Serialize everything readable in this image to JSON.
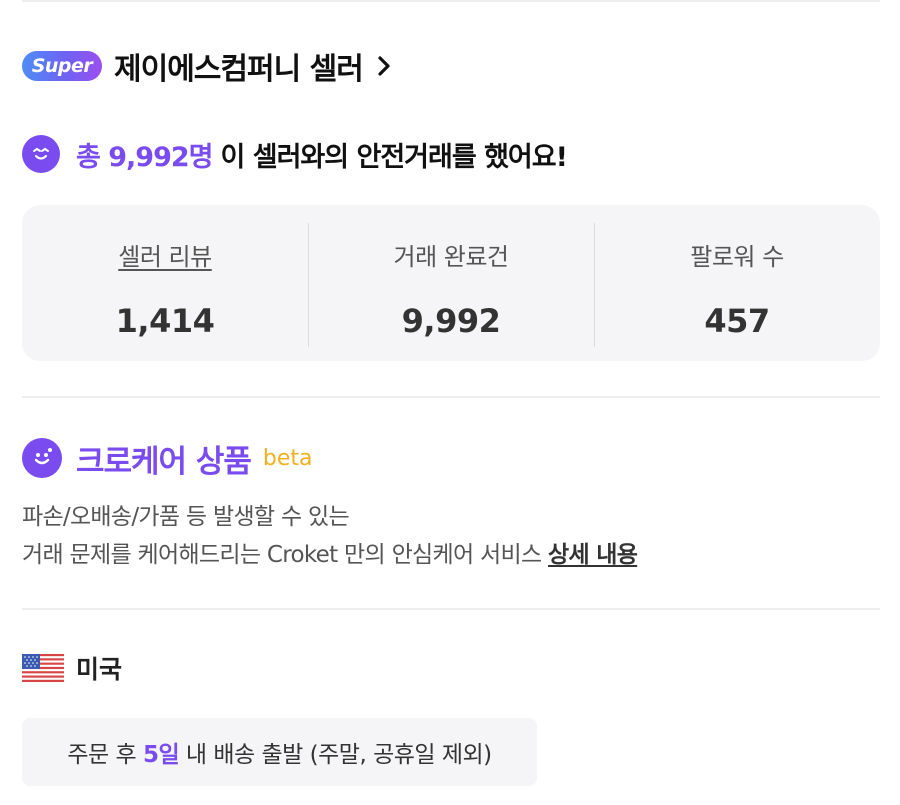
{
  "seller": {
    "badge": "Super",
    "name": "제이에스컴퍼니 셀러"
  },
  "trade": {
    "count_text": "총 9,992명",
    "suffix_text": "이 셀러와의 안전거래를 했어요!"
  },
  "stats": [
    {
      "label": "셀러 리뷰",
      "value": "1,414"
    },
    {
      "label": "거래 완료건",
      "value": "9,992"
    },
    {
      "label": "팔로워 수",
      "value": "457"
    }
  ],
  "crocare": {
    "title": "크로케어 상품",
    "beta": "beta",
    "line1": "파손/오배송/가품 등 발생할 수 있는",
    "line2": "거래 문제를 케어해드리는 Croket 만의 안심케어 서비스",
    "link": "상세 내용"
  },
  "country": {
    "name": "미국"
  },
  "shipping": {
    "prefix": "주문 후",
    "days": "5일",
    "suffix": "내 배송 출발 (주말, 공휴일 제외)"
  },
  "colors": {
    "accent": "#7a4cf0",
    "beta": "#f0b020",
    "panel": "#f5f5f7"
  },
  "icons": [
    "chevron-right-icon",
    "smile-icon",
    "care-smile-icon",
    "us-flag-icon"
  ]
}
